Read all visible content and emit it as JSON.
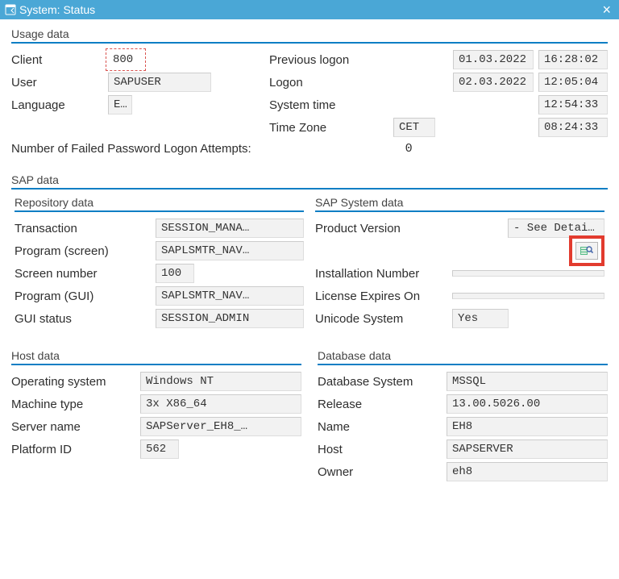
{
  "window": {
    "title": "System: Status"
  },
  "usage": {
    "section_title": "Usage data",
    "client_label": "Client",
    "client_value": "800",
    "user_label": "User",
    "user_value": "SAPUSER",
    "language_label": "Language",
    "language_value": "EN",
    "prev_logon_label": "Previous logon",
    "prev_logon_date": "01.03.2022",
    "prev_logon_time": "16:28:02",
    "logon_label": "Logon",
    "logon_date": "02.03.2022",
    "logon_time": "12:05:04",
    "system_time_label": "System time",
    "system_time_value": "12:54:33",
    "tz_label": "Time Zone",
    "tz_value": "CET",
    "tz_time": "08:24:33",
    "failed_label": "Number of Failed Password Logon Attempts:",
    "failed_value": "0"
  },
  "sapdata": {
    "section_title": "SAP data",
    "repository": {
      "section_title": "Repository data",
      "transaction_label": "Transaction",
      "transaction_value": "SESSION_MANA…",
      "program_screen_label": "Program (screen)",
      "program_screen_value": "SAPLSMTR_NAV…",
      "screen_number_label": "Screen number",
      "screen_number_value": "100",
      "program_gui_label": "Program (GUI)",
      "program_gui_value": "SAPLSMTR_NAV…",
      "gui_status_label": "GUI status",
      "gui_status_value": "SESSION_ADMIN"
    },
    "system": {
      "section_title": "SAP System data",
      "product_version_label": "Product Version",
      "product_version_value": "- See Details -",
      "installation_number_label": "Installation Number",
      "installation_number_value": "",
      "license_expires_label": "License Expires On",
      "license_expires_value": "",
      "unicode_label": "Unicode System",
      "unicode_value": "Yes"
    }
  },
  "host": {
    "section_title": "Host data",
    "os_label": "Operating system",
    "os_value": "Windows NT",
    "machine_type_label": "Machine type",
    "machine_type_value": "3x X86_64",
    "server_name_label": "Server name",
    "server_name_value": "SAPServer_EH8_…",
    "platform_id_label": "Platform ID",
    "platform_id_value": "562"
  },
  "db": {
    "section_title": "Database data",
    "system_label": "Database System",
    "system_value": "MSSQL",
    "release_label": "Release",
    "release_value": "13.00.5026.00",
    "name_label": "Name",
    "name_value": "EH8",
    "host_label": "Host",
    "host_value": "SAPSERVER",
    "owner_label": "Owner",
    "owner_value": "eh8"
  }
}
